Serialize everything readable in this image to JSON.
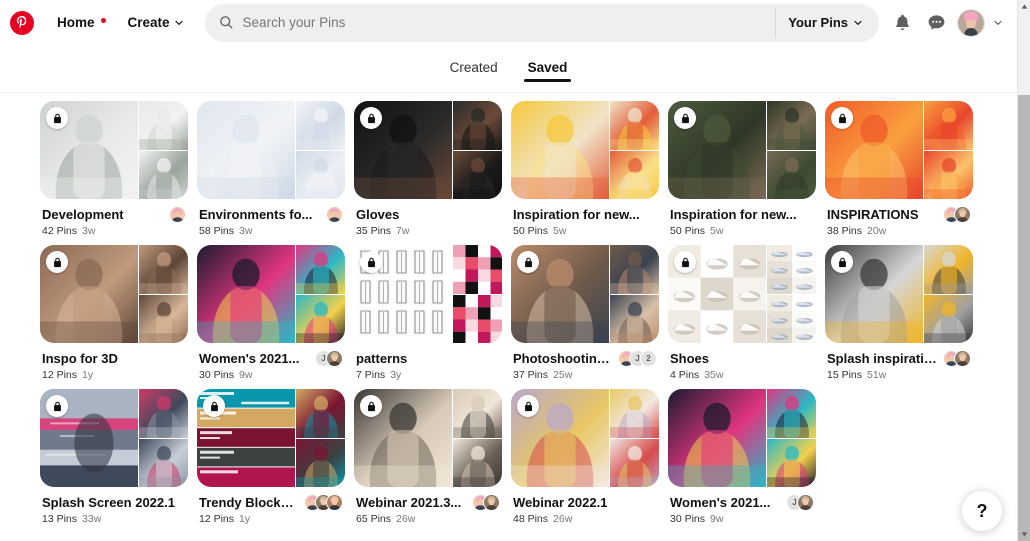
{
  "header": {
    "logo_icon": "pinterest-logo-icon",
    "home_label": "Home",
    "home_has_dot": true,
    "create_label": "Create",
    "search": {
      "placeholder": "Search your Pins",
      "value": "",
      "icon": "search-icon"
    },
    "your_pins_label": "Your Pins",
    "notifications_icon": "bell-icon",
    "messages_icon": "chat-bubble-icon",
    "avatar_icon": "profile-avatar",
    "account_caret_icon": "chevron-down-icon",
    "accent_color": "#e60023"
  },
  "tabs": [
    {
      "label": "Created",
      "active": false
    },
    {
      "label": "Saved",
      "active": true
    }
  ],
  "boards": [
    {
      "title": "Development",
      "pins": "42 Pins",
      "age": "3w",
      "secret": true,
      "collaborators": [
        "photo"
      ],
      "art": "development"
    },
    {
      "title": "Environments fo...",
      "pins": "58 Pins",
      "age": "3w",
      "secret": false,
      "collaborators": [
        "photo"
      ],
      "art": "environments"
    },
    {
      "title": "Gloves",
      "pins": "35 Pins",
      "age": "7w",
      "secret": true,
      "collaborators": [],
      "art": "gloves"
    },
    {
      "title": "Inspiration for new...",
      "pins": "50 Pins",
      "age": "5w",
      "secret": false,
      "collaborators": [],
      "art": "inspiration-yellow"
    },
    {
      "title": "Inspiration for new...",
      "pins": "50 Pins",
      "age": "5w",
      "secret": true,
      "collaborators": [],
      "art": "inspiration-group"
    },
    {
      "title": "INSPIRATIONS",
      "pins": "38 Pins",
      "age": "20w",
      "secret": true,
      "collaborators": [
        "photo",
        "photo"
      ],
      "art": "inspirations"
    },
    {
      "title": "Inspo for 3D",
      "pins": "12 Pins",
      "age": "1y",
      "secret": true,
      "collaborators": [],
      "art": "inspo3d"
    },
    {
      "title": "Women's 2021...",
      "pins": "30 Pins",
      "age": "9w",
      "secret": false,
      "collaborators": [
        "J",
        "photo"
      ],
      "art": "womens2021"
    },
    {
      "title": "patterns",
      "pins": "7 Pins",
      "age": "3y",
      "secret": true,
      "collaborators": [],
      "art": "patterns"
    },
    {
      "title": "Photoshooting...",
      "pins": "37 Pins",
      "age": "25w",
      "secret": true,
      "collaborators": [
        "photo",
        "J",
        "2"
      ],
      "art": "photoshooting"
    },
    {
      "title": "Shoes",
      "pins": "4 Pins",
      "age": "35w",
      "secret": true,
      "collaborators": [],
      "art": "shoes"
    },
    {
      "title": "Splash inspiratio...",
      "pins": "15 Pins",
      "age": "51w",
      "secret": true,
      "collaborators": [
        "photo",
        "photo"
      ],
      "art": "splash-insp"
    },
    {
      "title": "Splash Screen 2022.1",
      "pins": "13 Pins",
      "age": "33w",
      "secret": true,
      "collaborators": [],
      "art": "splash-screen"
    },
    {
      "title": "Trendy Blocks ...",
      "pins": "12 Pins",
      "age": "1y",
      "secret": true,
      "collaborators": [
        "photo",
        "photo",
        "photo"
      ],
      "art": "trendy-blocks"
    },
    {
      "title": "Webinar 2021.3...",
      "pins": "65 Pins",
      "age": "26w",
      "secret": true,
      "collaborators": [
        "photo",
        "photo"
      ],
      "art": "webinar2021"
    },
    {
      "title": "Webinar 2022.1",
      "pins": "48 Pins",
      "age": "26w",
      "secret": true,
      "collaborators": [],
      "art": "webinar2022"
    },
    {
      "title": "Women's 2021...",
      "pins": "30 Pins",
      "age": "9w",
      "secret": false,
      "collaborators": [
        "J",
        "photo"
      ],
      "art": "womens2021b"
    }
  ],
  "help_button": {
    "label": "?"
  },
  "scrollbar": {
    "up_icon": "caret-up-icon",
    "down_icon": "caret-down-icon"
  }
}
